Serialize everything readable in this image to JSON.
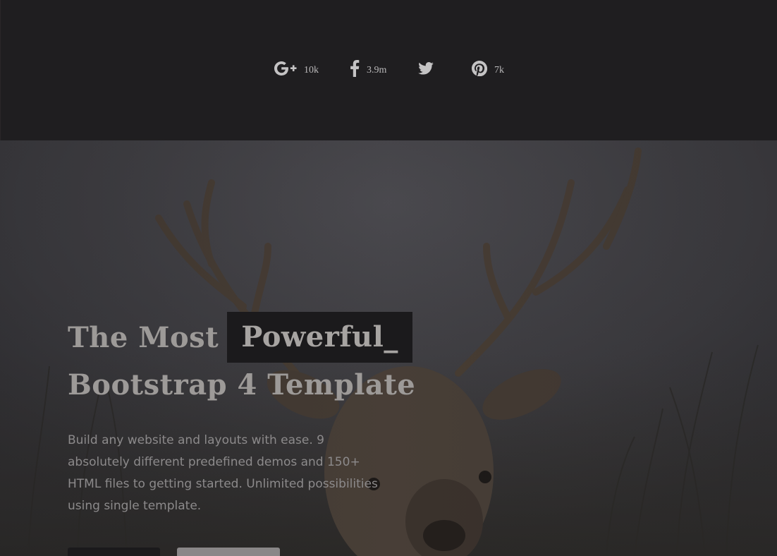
{
  "share": {
    "items": [
      {
        "network": "google-plus",
        "icon": "google-plus-icon",
        "count": "10k"
      },
      {
        "network": "facebook",
        "icon": "facebook-icon",
        "count": "3.9m"
      },
      {
        "network": "twitter",
        "icon": "twitter-icon",
        "count": ""
      },
      {
        "network": "pinterest",
        "icon": "pinterest-icon",
        "count": "7k"
      }
    ]
  },
  "hero": {
    "title_prefix": "The Most",
    "title_highlight": "Powerful_",
    "title_line2": "Bootstrap 4 Template",
    "description": "Build any website and layouts with ease. 9 absolutely different predefined demos and 150+ HTML files to getting started. Unlimited possibilities using single template.",
    "background": "deer-photo"
  },
  "colors": {
    "page_bg": "#1f1e20",
    "highlight_bg": "#1b1a1c",
    "title_text": "#9d9a98",
    "body_text": "#8c8a8b"
  }
}
